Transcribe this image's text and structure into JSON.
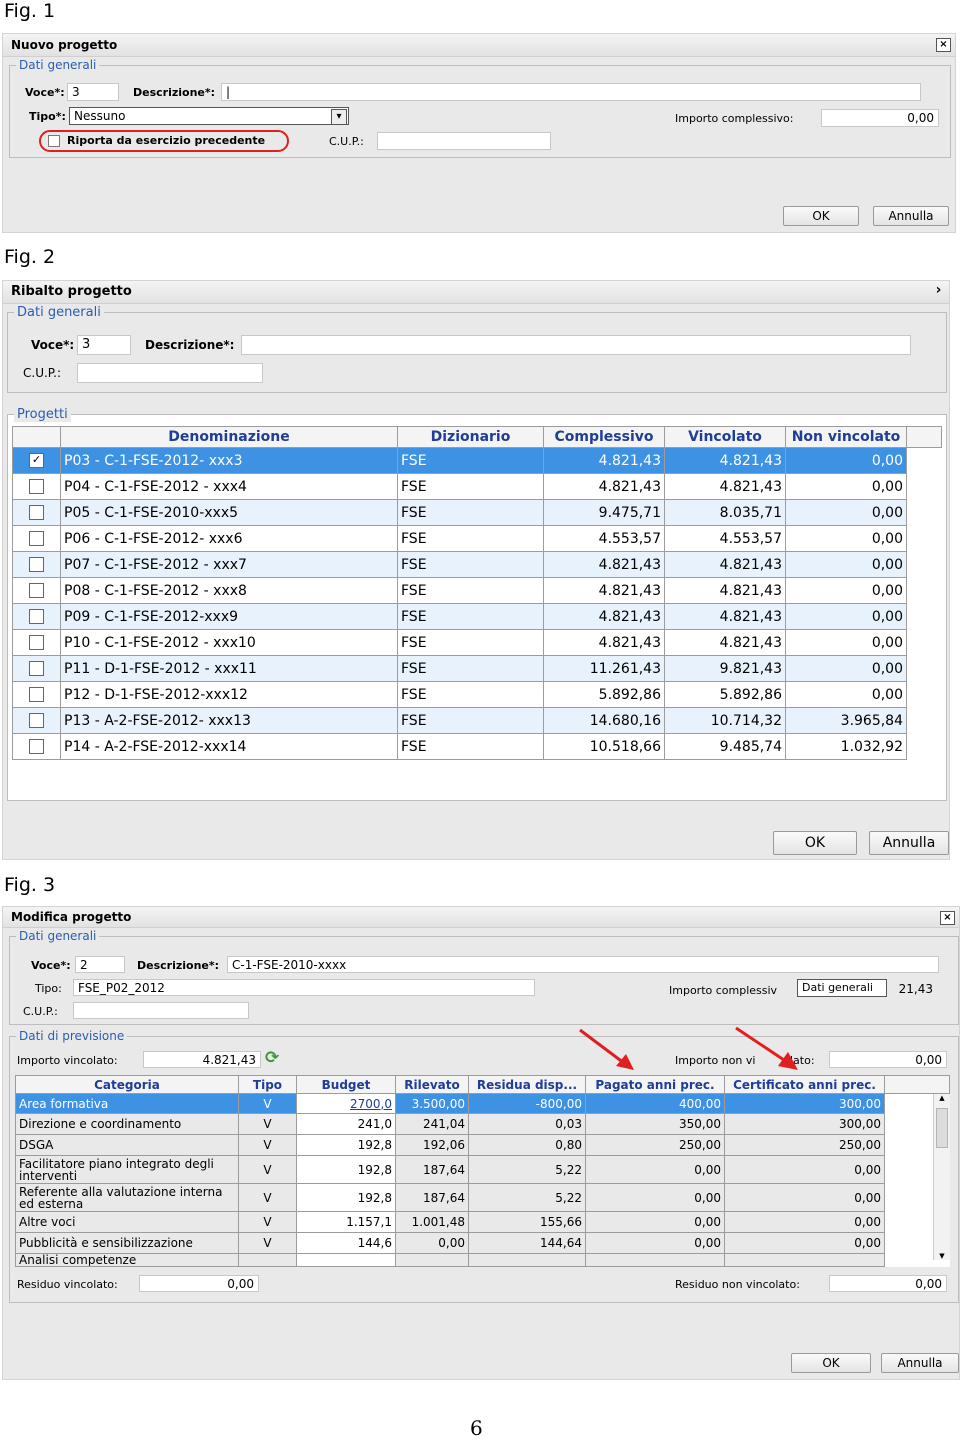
{
  "fig1": {
    "label": "Fig. 1",
    "title": "Nuovo progetto",
    "close_glyph": "×",
    "group": "Dati generali",
    "voce_label": "Voce*:",
    "voce_value": "3",
    "descrizione_label": "Descrizione*:",
    "descrizione_value": "|",
    "tipo_label": "Tipo*:",
    "tipo_value": "Nessuno",
    "tipo_arrow": "▾",
    "importo_label": "Importo complessivo:",
    "importo_value": "0,00",
    "riporta_label": "Riporta da esercizio precedente",
    "cup_label": "C.U.P.:",
    "cup_value": "",
    "ok_label": "OK",
    "annulla_label": "Annulla"
  },
  "fig2": {
    "label": "Fig. 2",
    "title": "Ribalto progetto",
    "close_glyph": "›",
    "group": "Dati generali",
    "voce_label": "Voce*:",
    "voce_value": "3",
    "descrizione_label": "Descrizione*:",
    "descrizione_value": "",
    "cup_label": "C.U.P.:",
    "cup_value": "",
    "progetti_group": "Progetti",
    "columns": [
      "Denominazione",
      "Dizionario",
      "Complessivo",
      "Vincolato",
      "Non vincolato"
    ],
    "rows": [
      {
        "checked": true,
        "check": "✓",
        "den": "P03 - C-1-FSE-2012- xxx3",
        "diz": "FSE",
        "comp": "4.821,43",
        "vinc": "4.821,43",
        "nonv": "0,00"
      },
      {
        "checked": false,
        "check": "",
        "den": "P04 - C-1-FSE-2012 - xxx4",
        "diz": "FSE",
        "comp": "4.821,43",
        "vinc": "4.821,43",
        "nonv": "0,00"
      },
      {
        "checked": false,
        "check": "",
        "den": "P05 - C-1-FSE-2010-xxx5",
        "diz": "FSE",
        "comp": "9.475,71",
        "vinc": "8.035,71",
        "nonv": "0,00"
      },
      {
        "checked": false,
        "check": "",
        "den": "P06 - C-1-FSE-2012- xxx6",
        "diz": "FSE",
        "comp": "4.553,57",
        "vinc": "4.553,57",
        "nonv": "0,00"
      },
      {
        "checked": false,
        "check": "",
        "den": "P07 - C-1-FSE-2012 - xxx7",
        "diz": "FSE",
        "comp": "4.821,43",
        "vinc": "4.821,43",
        "nonv": "0,00"
      },
      {
        "checked": false,
        "check": "",
        "den": "P08 - C-1-FSE-2012 - xxx8",
        "diz": "FSE",
        "comp": "4.821,43",
        "vinc": "4.821,43",
        "nonv": "0,00"
      },
      {
        "checked": false,
        "check": "",
        "den": "P09 - C-1-FSE-2012-xxx9",
        "diz": "FSE",
        "comp": "4.821,43",
        "vinc": "4.821,43",
        "nonv": "0,00"
      },
      {
        "checked": false,
        "check": "",
        "den": "P10 - C-1-FSE-2012 - xxx10",
        "diz": "FSE",
        "comp": "4.821,43",
        "vinc": "4.821,43",
        "nonv": "0,00"
      },
      {
        "checked": false,
        "check": "",
        "den": "P11 - D-1-FSE-2012 - xxx11",
        "diz": "FSE",
        "comp": "11.261,43",
        "vinc": "9.821,43",
        "nonv": "0,00"
      },
      {
        "checked": false,
        "check": "",
        "den": "P12 - D-1-FSE-2012-xxx12",
        "diz": "FSE",
        "comp": "5.892,86",
        "vinc": "5.892,86",
        "nonv": "0,00"
      },
      {
        "checked": false,
        "check": "",
        "den": "P13 - A-2-FSE-2012- xxx13",
        "diz": "FSE",
        "comp": "14.680,16",
        "vinc": "10.714,32",
        "nonv": "3.965,84"
      },
      {
        "checked": false,
        "check": "",
        "den": "P14 - A-2-FSE-2012-xxx14",
        "diz": "FSE",
        "comp": "10.518,66",
        "vinc": "9.485,74",
        "nonv": "1.032,92"
      }
    ],
    "ok_label": "OK",
    "annulla_label": "Annulla"
  },
  "fig3": {
    "label": "Fig. 3",
    "title": "Modifica progetto",
    "close_glyph": "×",
    "group": "Dati generali",
    "voce_label": "Voce*:",
    "voce_value": "2",
    "descrizione_label": "Descrizione*:",
    "descrizione_value": "C-1-FSE-2010-xxxx",
    "tipo_label": "Tipo:",
    "tipo_value": "FSE_P02_2012",
    "importo_label": "Importo complessiv",
    "tooltip": "Dati generali",
    "importo_value": "21,43",
    "cup_label": "C.U.P.:",
    "cup_value": "",
    "previsione_group": "Dati di previsione",
    "importo_vincolato_label": "Importo vincolato:",
    "importo_vincolato_value": "4.821,43",
    "refresh_glyph": "⟳",
    "importo_non_vincolato_label_a": "Importo non vi",
    "importo_non_vincolato_label_b": "lato:",
    "importo_non_vincolato_value": "0,00",
    "columns": [
      "Categoria",
      "Tipo",
      "Budget",
      "Rilevato",
      "Residua disp...",
      "Pagato anni prec.",
      "Certificato anni prec."
    ],
    "rows": [
      {
        "cat": "Area formativa",
        "tipo": "V",
        "budget": "2700,0",
        "ril": "3.500,00",
        "res": "-800,00",
        "pag": "400,00",
        "cert": "300,00"
      },
      {
        "cat": "Direzione e coordinamento",
        "tipo": "V",
        "budget": "241,0",
        "ril": "241,04",
        "res": "0,03",
        "pag": "350,00",
        "cert": "300,00"
      },
      {
        "cat": "DSGA",
        "tipo": "V",
        "budget": "192,8",
        "ril": "192,06",
        "res": "0,80",
        "pag": "250,00",
        "cert": "250,00"
      },
      {
        "cat": "Facilitatore piano integrato degli interventi",
        "tipo": "V",
        "budget": "192,8",
        "ril": "187,64",
        "res": "5,22",
        "pag": "0,00",
        "cert": "0,00"
      },
      {
        "cat": "Referente alla valutazione interna ed esterna",
        "tipo": "V",
        "budget": "192,8",
        "ril": "187,64",
        "res": "5,22",
        "pag": "0,00",
        "cert": "0,00"
      },
      {
        "cat": "Altre voci",
        "tipo": "V",
        "budget": "1.157,1",
        "ril": "1.001,48",
        "res": "155,66",
        "pag": "0,00",
        "cert": "0,00"
      },
      {
        "cat": "Pubblicità e sensibilizzazione",
        "tipo": "V",
        "budget": "144,6",
        "ril": "0,00",
        "res": "144,64",
        "pag": "0,00",
        "cert": "0,00"
      },
      {
        "cat": "Analisi competenze",
        "tipo": "",
        "budget": "",
        "ril": "",
        "res": "",
        "pag": "",
        "cert": ""
      }
    ],
    "residuo_vincolato_label": "Residuo vincolato:",
    "residuo_vincolato_value": "0,00",
    "residuo_non_vincolato_label": "Residuo non vincolato:",
    "residuo_non_vincolato_value": "0,00",
    "scroll_up": "▲",
    "scroll_down": "▼",
    "ok_label": "OK",
    "annulla_label": "Annulla",
    "highlight_color": "#e02020"
  },
  "page_number": "6"
}
